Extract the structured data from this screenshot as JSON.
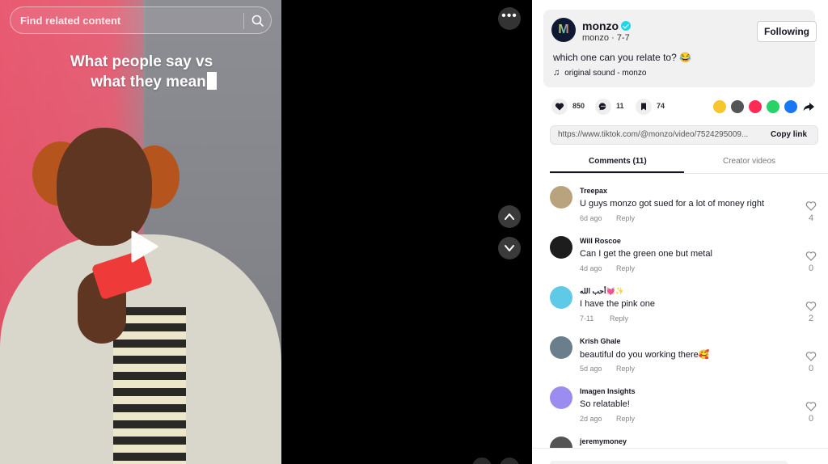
{
  "search": {
    "placeholder": "Find related content"
  },
  "video": {
    "overlay_line1": "What people say vs",
    "overlay_line2": "what they mean"
  },
  "author": {
    "name": "monzo",
    "handle": "monzo",
    "date": "7-7",
    "follow_label": "Following",
    "caption": "which one can you relate to? 😂",
    "music": "original sound - monzo"
  },
  "actions": {
    "likes": "850",
    "comments": "11",
    "saves": "74"
  },
  "link": {
    "url": "https://www.tiktok.com/@monzo/video/7524295009...",
    "copy_label": "Copy link"
  },
  "tabs": {
    "comments": "Comments (11)",
    "creator": "Creator videos"
  },
  "comments": [
    {
      "user": "Treepax",
      "text": "U guys monzo got sued for a lot of money right",
      "date": "6d ago",
      "reply": "Reply",
      "likes": "4",
      "avatar_color": "#b9a27e"
    },
    {
      "user": "Will Roscoe",
      "text": "Can I get the green one but metal",
      "date": "4d ago",
      "reply": "Reply",
      "likes": "0",
      "avatar_color": "#1d1d1d"
    },
    {
      "user": "أحب الله💓✨",
      "text": "I have the pink one",
      "date": "7-11",
      "reply": "Reply",
      "likes": "2",
      "avatar_color": "#5fc9e8"
    },
    {
      "user": "Krish Ghale",
      "text": "beautiful do you working there🥰",
      "date": "5d ago",
      "reply": "Reply",
      "likes": "0",
      "avatar_color": "#6a7e8c"
    },
    {
      "user": "Imagen Insights",
      "text": "So relatable!",
      "date": "2d ago",
      "reply": "Reply",
      "likes": "0",
      "avatar_color": "#9b8df0"
    },
    {
      "user": "jeremymoney",
      "text": "",
      "date": "",
      "reply": "",
      "likes": "",
      "avatar_color": "#555555"
    }
  ],
  "colors": {
    "accent": "#fe2c55",
    "verified": "#20d5ec",
    "video_wall_pink": "#e8526a"
  }
}
